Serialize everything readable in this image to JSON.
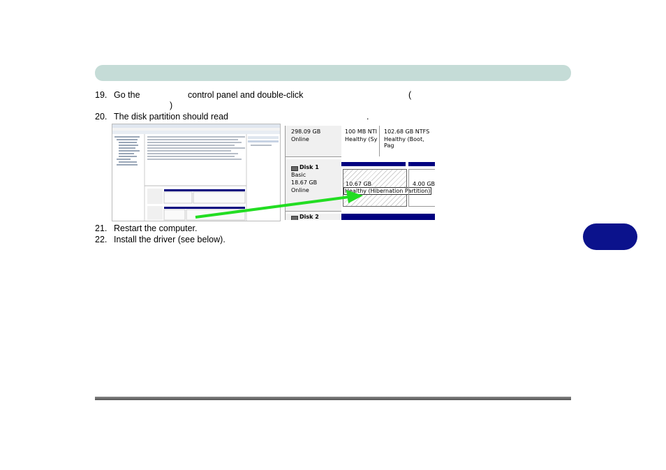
{
  "steps": [
    {
      "num": "19.",
      "text_a": "Go the",
      "text_b": "control panel and double-click",
      "text_c": "(",
      "text_d": ")"
    },
    {
      "num": "20.",
      "text_a": "The disk partition should read",
      "text_b": "."
    },
    {
      "num": "21.",
      "text_a": "Restart the computer."
    },
    {
      "num": "22.",
      "text_a": "Install the driver (see below)."
    }
  ],
  "disk_panel": {
    "disk0_size": "298.09 GB",
    "disk0_status": "Online",
    "part1_size": "100 MB NTI",
    "part1_health": "Healthy (Sy",
    "part2_size": "102.68 GB NTFS",
    "part2_health": "Healthy (Boot, Pag",
    "disk1_name": "Disk 1",
    "disk1_type": "Basic",
    "disk1_size": "18.67 GB",
    "disk1_status": "Online",
    "hib_size": "10.67 GB",
    "hib_health": "Healthy (Hibernation Partition)",
    "free_size": "4.00 GB",
    "disk2_name": "Disk 2"
  },
  "colors": {
    "header": "#c5dcd7",
    "tab": "#0b128c",
    "arrow": "#22dd22",
    "volume_bar": "#000080"
  }
}
